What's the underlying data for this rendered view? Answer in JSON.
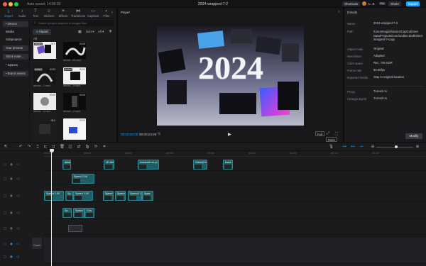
{
  "titlebar": {
    "autosave": "Auto saved: 14:06:20",
    "title": "2024-wrapped-7-2",
    "shortcuts": "Shortcuts",
    "user": "A...5",
    "pro": "Pro",
    "share": "Share",
    "export": "Export",
    "colors": {
      "export": "#1ea3ff",
      "close": "#ff5f57",
      "minimize": "#febc2e",
      "zoom": "#28c840"
    }
  },
  "media": {
    "tabs": [
      {
        "label": "Import",
        "icon": "import-icon"
      },
      {
        "label": "Audio",
        "icon": "audio-icon"
      },
      {
        "label": "Text",
        "icon": "text-icon"
      },
      {
        "label": "Stickers",
        "icon": "stickers-icon"
      },
      {
        "label": "Effects",
        "icon": "effects-icon"
      },
      {
        "label": "Transitions",
        "icon": "transitions-icon"
      },
      {
        "label": "Captions",
        "icon": "captions-icon"
      },
      {
        "label": "Filter",
        "icon": "filter-icon"
      }
    ],
    "side": [
      "• Device",
      "Media",
      "Subprojects",
      "Your presets",
      "Stock mate...",
      "• Spaces",
      "• Brand assets"
    ],
    "search_placeholder": "Search project subjects of images files",
    "import_label": "Import",
    "sort_label": "Sort",
    "all_label": "All",
    "items": [
      {
        "label": "",
        "badge": "Added",
        "duration": "00:0"
      },
      {
        "label": "abstra...e6.mp4",
        "badge": "",
        "duration": "00:08"
      },
      {
        "label": "abstra...-7.mp4",
        "badge": "Added",
        "duration": "00:03"
      },
      {
        "label": "abstra...-5.mp4",
        "badge": "Added",
        "duration": "00:04"
      },
      {
        "label": "abstra...-3.mp4",
        "badge": "",
        "duration": "00:05"
      },
      {
        "label": "abstra...-2.mp4",
        "badge": "",
        "duration": "00:05"
      },
      {
        "label": "",
        "badge": "",
        "duration": "00:0"
      },
      {
        "label": "",
        "badge": "",
        "duration": "00:03"
      }
    ]
  },
  "player": {
    "title": "Player",
    "video_text": "2024",
    "timecode_current": "00:00:00:09",
    "timecode_duration": "00:00:24:25",
    "full_label": "Full",
    "ratio_label": "Ratio"
  },
  "details": {
    "title": "Details",
    "rows": [
      {
        "key": "Name",
        "value": "2024-wrapped-7-2"
      },
      {
        "key": "Path",
        "value": "/Users/eugis/Movies/CapCut/User Data/Projects/com.lveditor.draft/2024-wrapped-7-copy"
      },
      {
        "key": "Aspect ratio",
        "value": "Original"
      },
      {
        "key": "Resolution",
        "value": "Adapted"
      },
      {
        "key": "Color space",
        "value": "Rec. 709 SDR"
      },
      {
        "key": "Frame rate",
        "value": "60.00fps"
      },
      {
        "key": "Imported media",
        "value": "Stay in original location"
      },
      {
        "key": "Proxy",
        "value": "Turned on"
      },
      {
        "key": "Arrange layers",
        "value": "Turned on"
      }
    ],
    "modify": "Modify"
  },
  "timeline": {
    "ruler": [
      "00:00",
      "|00:10",
      "|00:20",
      "|00:30",
      "|00:40",
      "|00:50",
      "|01:00",
      "|01:10",
      "|01:20"
    ],
    "cover_label": "Cover",
    "clips": [
      {
        "label": "abstr",
        "track": 0,
        "start": 88,
        "width": 12
      },
      {
        "label": "LE-abs",
        "track": 0,
        "start": 146,
        "width": 15
      },
      {
        "label": "macbook-on-pi",
        "track": 0,
        "start": 194,
        "width": 30
      },
      {
        "label": "Clean(On",
        "track": 0,
        "start": 272,
        "width": 20
      },
      {
        "label": "black",
        "track": 0,
        "start": 314,
        "width": 14
      },
      {
        "label": "Speed 2.0X",
        "track": 1,
        "start": 101,
        "width": 32
      },
      {
        "label": "Speed 1.0X",
        "track": 2,
        "start": 62,
        "width": 28
      },
      {
        "label": "Sp",
        "track": 2,
        "start": 92,
        "width": 11
      },
      {
        "label": "Speed 1.0X",
        "track": 2,
        "start": 103,
        "width": 28
      },
      {
        "label": "Speed",
        "track": 2,
        "start": 145,
        "width": 15
      },
      {
        "label": "Speed",
        "track": 2,
        "start": 162,
        "width": 15
      },
      {
        "label": "Speed 1.0",
        "track": 2,
        "start": 180,
        "width": 20
      },
      {
        "label": "Spee",
        "track": 2,
        "start": 200,
        "width": 16
      },
      {
        "label": "Sp",
        "track": 3,
        "start": 88,
        "width": 13
      },
      {
        "label": "Speed",
        "track": 3,
        "start": 103,
        "width": 16
      },
      {
        "label": "Con",
        "track": 3,
        "start": 119,
        "width": 14
      }
    ]
  }
}
